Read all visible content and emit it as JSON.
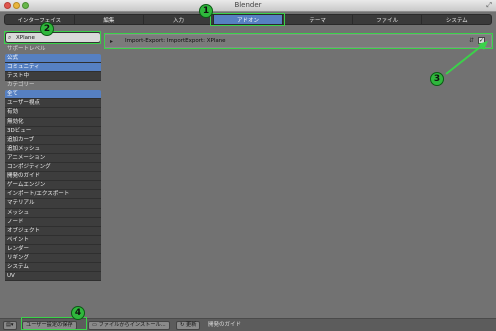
{
  "window": {
    "title": "Blender"
  },
  "tabs": [
    {
      "label": "インターフェイス"
    },
    {
      "label": "編集"
    },
    {
      "label": "入力"
    },
    {
      "label": "アドオン",
      "active": true
    },
    {
      "label": "テーマ"
    },
    {
      "label": "ファイル"
    },
    {
      "label": "システム"
    }
  ],
  "sidebar": {
    "search_value": "XPlane",
    "support_heading": "サポートレベル",
    "support_items": [
      {
        "label": "公式",
        "selected": true
      },
      {
        "label": "コミュニティ",
        "selected": true
      },
      {
        "label": "テスト中",
        "selected": false
      }
    ],
    "category_heading": "カテゴリー",
    "categories": [
      {
        "label": "全て",
        "selected": true
      },
      {
        "label": "ユーザー視点"
      },
      {
        "label": "有効"
      },
      {
        "label": "無効化"
      },
      {
        "label": "3Dビュー"
      },
      {
        "label": "追加カーブ"
      },
      {
        "label": "追加メッシュ"
      },
      {
        "label": "アニメーション"
      },
      {
        "label": "コンポジティング"
      },
      {
        "label": "開発のガイド"
      },
      {
        "label": "ゲームエンジン"
      },
      {
        "label": "インポート/エクスポート"
      },
      {
        "label": "マテリアル"
      },
      {
        "label": "メッシュ"
      },
      {
        "label": "ノード"
      },
      {
        "label": "オブジェクト"
      },
      {
        "label": "ペイント"
      },
      {
        "label": "レンダー"
      },
      {
        "label": "リギング"
      },
      {
        "label": "システム"
      },
      {
        "label": "UV"
      }
    ]
  },
  "addon": {
    "name": "Import-Export: ImportExport: XPlane",
    "enabled": true
  },
  "footer": {
    "save_label": "ユーザー設定の保存",
    "install_label": "ファイルからインストール...",
    "refresh_label": "更新",
    "guide_label": "開発のガイド"
  },
  "callouts": [
    "1",
    "2",
    "3",
    "4"
  ],
  "colors": {
    "highlight": "#3bd24a",
    "selected": "#5680c2"
  }
}
